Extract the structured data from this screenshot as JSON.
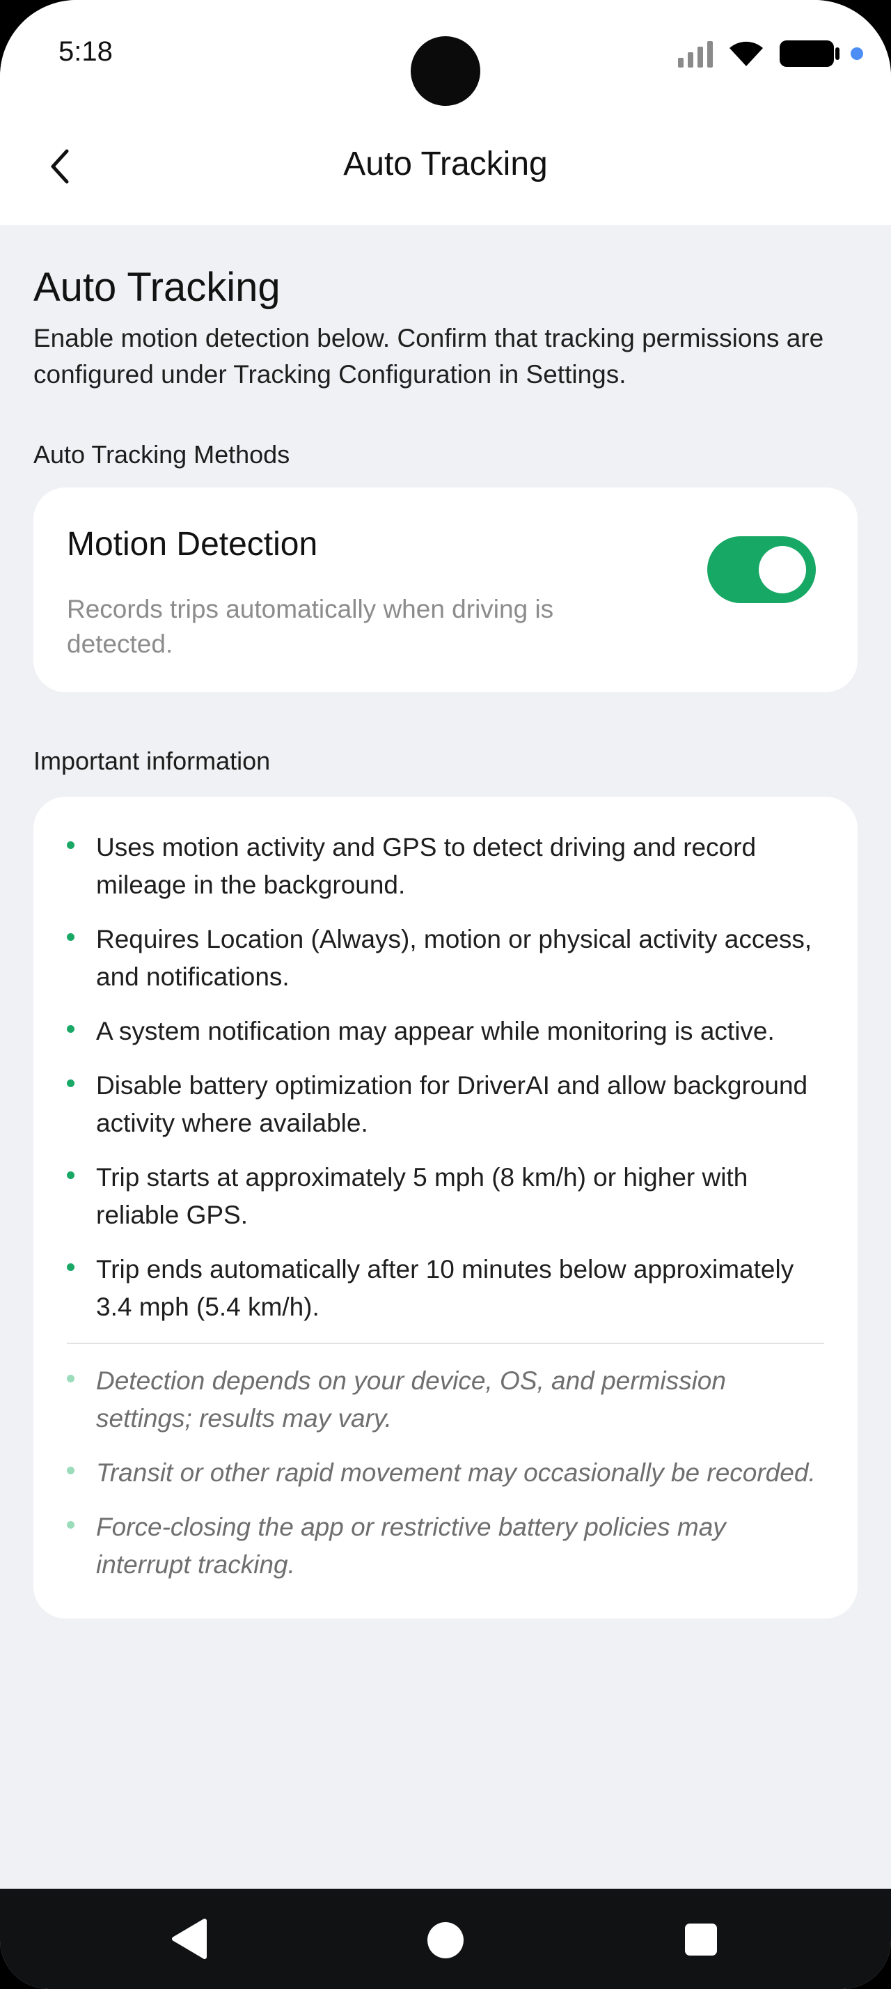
{
  "status_bar": {
    "time": "5:18"
  },
  "header": {
    "title": "Auto Tracking",
    "back_icon": "chevron-left-icon"
  },
  "intro": {
    "title": "Auto Tracking",
    "description": "Enable motion detection below. Confirm that tracking permissions are configured under Tracking Configuration in Settings."
  },
  "methods": {
    "section_label": "Auto Tracking Methods",
    "motion_detection": {
      "title": "Motion Detection",
      "description": "Records trips automatically when driving is detected.",
      "enabled": true
    }
  },
  "important": {
    "section_label": "Important information",
    "items": [
      "Uses motion activity and GPS to detect driving and record mileage in the background.",
      "Requires Location (Always), motion or physical activity access, and notifications.",
      "A system notification may appear while monitoring is active.",
      "Disable battery optimization for DriverAI and allow background activity where available.",
      "Trip starts at approximately 5 mph (8 km/h) or higher with reliable GPS.",
      "Trip ends automatically after 10 minutes below approximately 3.4 mph (5.4 km/h)."
    ],
    "notes": [
      "Detection depends on your device, OS, and permission settings; results may vary.",
      "Transit or other rapid movement may occasionally be recorded.",
      "Force-closing the app or restrictive battery policies may interrupt tracking."
    ]
  },
  "colors": {
    "accent_green": "#17A865",
    "background": "#F0F1F4",
    "card": "#FFFFFF"
  }
}
